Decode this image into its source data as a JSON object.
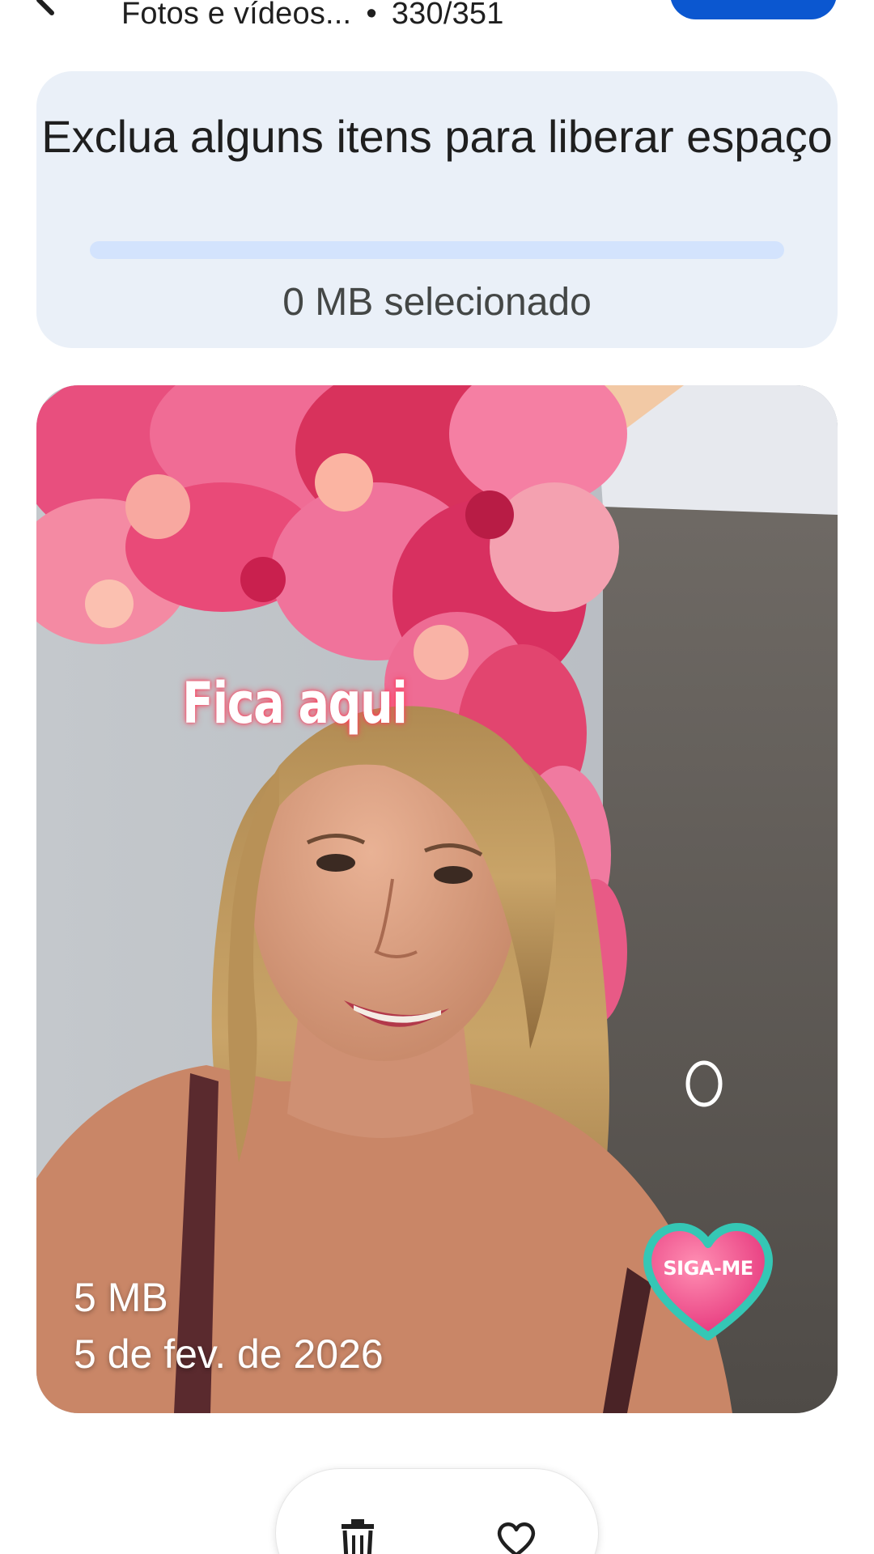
{
  "header": {
    "subtitle_text": "Fotos e vídeos...",
    "separator": "•",
    "count": "330/351",
    "icons": [
      "back-arrow-icon",
      "item-icon"
    ],
    "action_color": "#0b57d0"
  },
  "storage_card": {
    "title": "Exclua alguns itens para liberar espaço",
    "progress_fraction": 0,
    "selected_label": "0 MB selecionado",
    "background": "#eaf0f8"
  },
  "photo": {
    "overlay_caption": "Fica aqui",
    "sticker_label": "SIGA-ME",
    "size": "5 MB",
    "date": "5 de fev. de 2026"
  },
  "actions": {
    "icons": [
      "trash-icon",
      "heart-outline-icon"
    ]
  }
}
